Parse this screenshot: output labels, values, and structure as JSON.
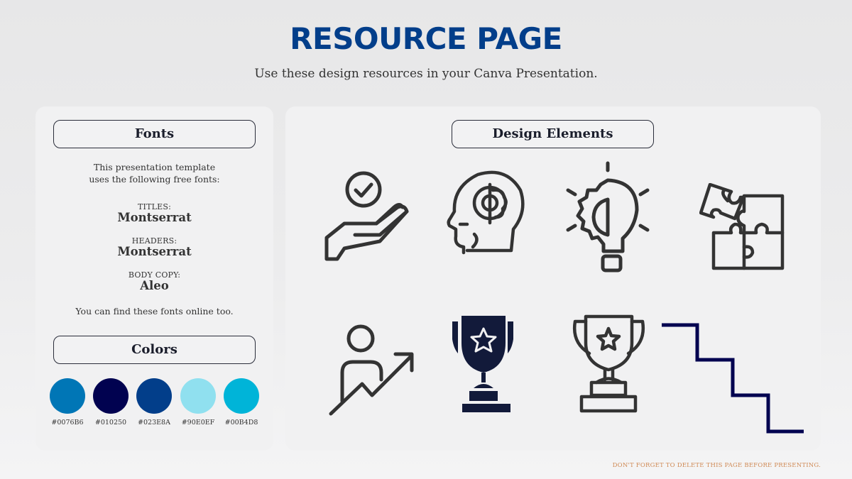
{
  "header": {
    "title": "RESOURCE PAGE",
    "subtitle": "Use these design resources in your Canva Presentation."
  },
  "fonts_panel": {
    "heading": "Fonts",
    "intro_line1": "This presentation template",
    "intro_line2": "uses the following free fonts:",
    "fonts": [
      {
        "label": "TITLES:",
        "name": "Montserrat"
      },
      {
        "label": "HEADERS:",
        "name": "Montserrat"
      },
      {
        "label": "BODY COPY:",
        "name": "Aleo"
      }
    ],
    "note": "You can find these fonts online too."
  },
  "colors_panel": {
    "heading": "Colors",
    "swatches": [
      {
        "hex": "#0076B6",
        "color": "#0076B6"
      },
      {
        "hex": "#010250",
        "color": "#010250"
      },
      {
        "hex": "#023E8A",
        "color": "#023E8A"
      },
      {
        "hex": "#90E0EF",
        "color": "#90E0EF"
      },
      {
        "hex": "#00B4D8",
        "color": "#00B4D8"
      }
    ]
  },
  "design_elements": {
    "heading": "Design Elements",
    "icons": [
      "hand-checkmark-icon",
      "head-gear-brain-icon",
      "lightbulb-gear-icon",
      "puzzle-pieces-icon",
      "person-growth-arrow-icon",
      "trophy-solid-icon",
      "trophy-outline-icon",
      "stairs-icon"
    ]
  },
  "footer": {
    "note": "DON'T FORGET TO DELETE THIS PAGE BEFORE PRESENTING."
  }
}
